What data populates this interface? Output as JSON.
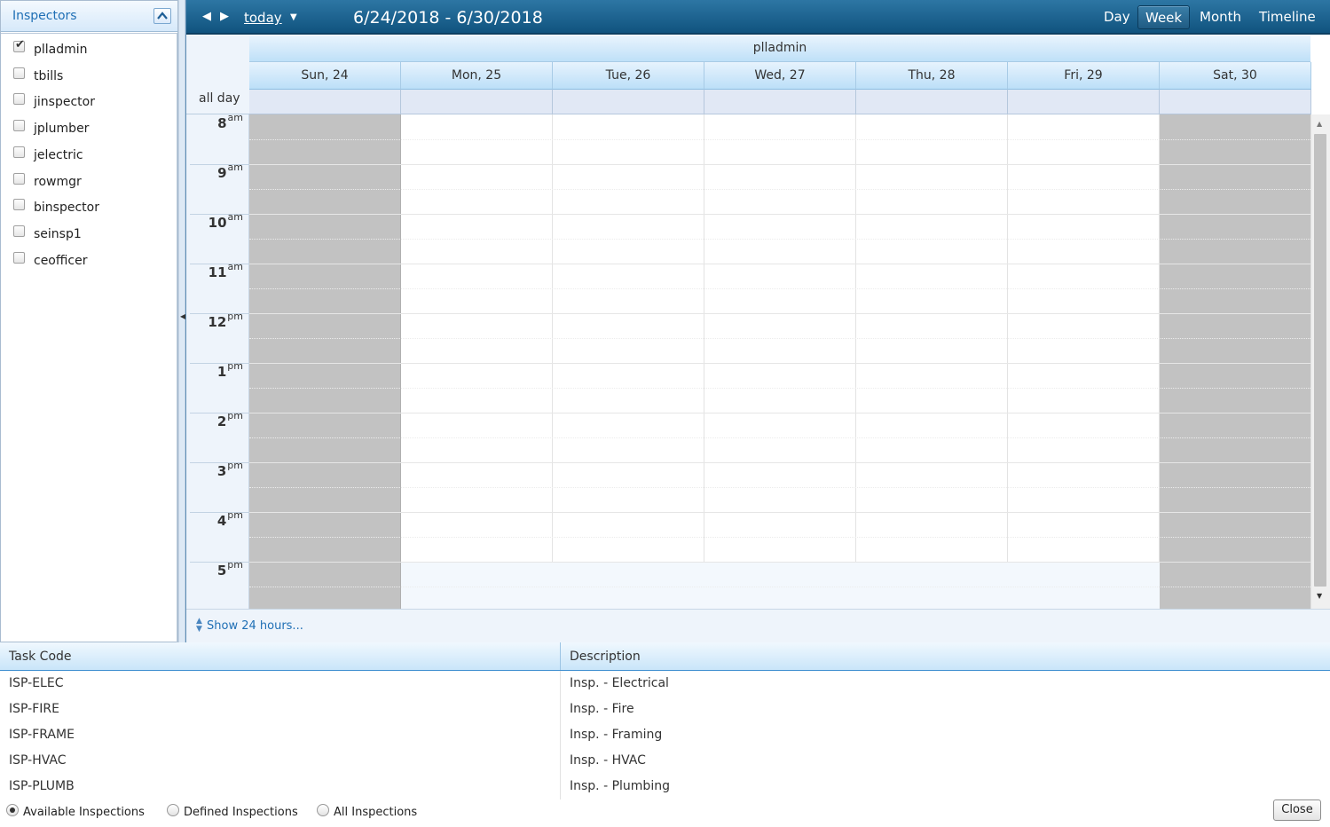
{
  "inspectors_panel": {
    "title": "Inspectors",
    "items": [
      {
        "label": "plladmin",
        "checked": true
      },
      {
        "label": "tbills",
        "checked": false
      },
      {
        "label": "jinspector",
        "checked": false
      },
      {
        "label": "jplumber",
        "checked": false
      },
      {
        "label": "jelectric",
        "checked": false
      },
      {
        "label": "rowmgr",
        "checked": false
      },
      {
        "label": "binspector",
        "checked": false
      },
      {
        "label": "seinsp1",
        "checked": false
      },
      {
        "label": "ceofficer",
        "checked": false
      }
    ]
  },
  "scheduler": {
    "toolbar": {
      "today_label": "today",
      "date_range": "6/24/2018 - 6/30/2018",
      "views": [
        "Day",
        "Week",
        "Month",
        "Timeline"
      ],
      "active_view": "Week"
    },
    "resource": "plladmin",
    "days": [
      "Sun, 24",
      "Mon, 25",
      "Tue, 26",
      "Wed, 27",
      "Thu, 28",
      "Fri, 29",
      "Sat, 30"
    ],
    "weekend_days": [
      "Sun, 24",
      "Sat, 30"
    ],
    "allday_label": "all day",
    "hours": [
      {
        "h": "8",
        "ampm": "am"
      },
      {
        "h": "9",
        "ampm": "am"
      },
      {
        "h": "10",
        "ampm": "am"
      },
      {
        "h": "11",
        "ampm": "am"
      },
      {
        "h": "12",
        "ampm": "pm"
      },
      {
        "h": "1",
        "ampm": "pm"
      },
      {
        "h": "2",
        "ampm": "pm"
      },
      {
        "h": "3",
        "ampm": "pm"
      },
      {
        "h": "4",
        "ampm": "pm"
      },
      {
        "h": "5",
        "ampm": "pm"
      }
    ],
    "show_hours_link": "Show 24 hours..."
  },
  "task_grid": {
    "columns": [
      "Task Code",
      "Description"
    ],
    "rows": [
      [
        "ISP-ELEC",
        "Insp. - Electrical"
      ],
      [
        "ISP-FIRE",
        "Insp. - Fire"
      ],
      [
        "ISP-FRAME",
        "Insp. - Framing"
      ],
      [
        "ISP-HVAC",
        "Insp. - HVAC"
      ],
      [
        "ISP-PLUMB",
        "Insp. - Plumbing"
      ]
    ]
  },
  "filter": {
    "options": [
      "Available Inspections",
      "Defined Inspections",
      "All Inspections"
    ],
    "selected": "Available Inspections"
  },
  "close_label": "Close",
  "colors": {
    "toolbar": "#1d6592",
    "header_light": "#bfe0f8",
    "weekend": "#c2c2c2",
    "link": "#1f6fb5"
  }
}
